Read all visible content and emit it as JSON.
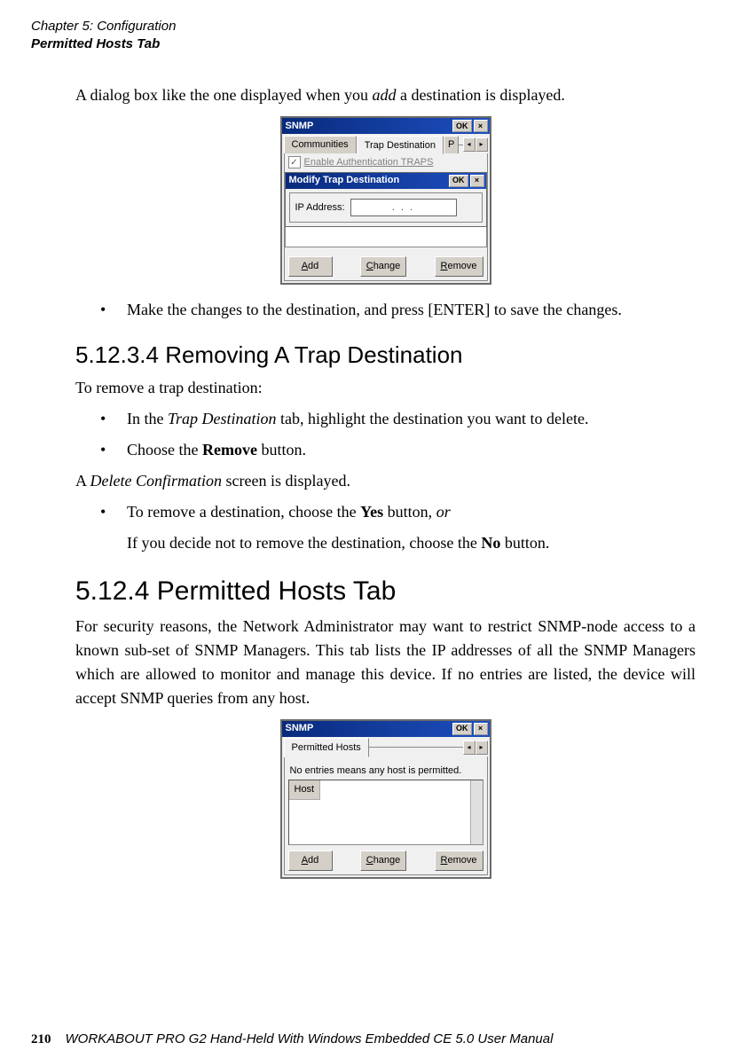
{
  "header": {
    "chapter": "Chapter 5: Configuration",
    "section": "Permitted Hosts Tab"
  },
  "body": {
    "p1_a": "A dialog box like the one displayed when you ",
    "p1_b": "add",
    "p1_c": " a destination is displayed.",
    "bullet_changes": "Make the changes to the destination, and press [ENTER] to save the changes.",
    "h_51234": "5.12.3.4   Removing A Trap Destination",
    "p_remove_intro": "To remove a trap destination:",
    "bullet_intrap_a": "In the ",
    "bullet_intrap_b": "Trap Destination",
    "bullet_intrap_c": " tab, highlight the destination you want to delete.",
    "bullet_choose_a": "Choose the ",
    "bullet_choose_b": "Remove",
    "bullet_choose_c": " button.",
    "p_delconf_a": "A ",
    "p_delconf_b": "Delete Confirmation",
    "p_delconf_c": " screen is displayed.",
    "bullet_yes_a": "To remove a destination, choose the ",
    "bullet_yes_b": "Yes",
    "bullet_yes_c": " button, ",
    "bullet_yes_d": "or",
    "sub_no_a": "If you decide not to remove the destination, choose the ",
    "sub_no_b": "No",
    "sub_no_c": " button.",
    "h_5124": "5.12.4   Permitted Hosts Tab",
    "p_permitted": "For security reasons, the Network Administrator may want to restrict SNMP-node access to a known sub-set of SNMP Managers. This tab lists the IP addresses of all the SNMP Managers which are allowed to monitor and manage this device. If no entries are listed, the device will accept SNMP queries from any host."
  },
  "dialog1": {
    "title": "SNMP",
    "ok": "OK",
    "close": "×",
    "tab1": "Communities",
    "tab2": "Trap Destination",
    "tab3": "P",
    "checkbox_label": "Enable Authentication TRAPS",
    "check": "✓",
    "arrow_left": "◂",
    "arrow_right": "▸",
    "inner_title": "Modify Trap Destination",
    "ip_label": "IP Address:",
    "ip_value": ".       .       .",
    "add_u": "A",
    "add_r": "dd",
    "change_u": "C",
    "change_r": "hange",
    "remove_u": "R",
    "remove_r": "emove"
  },
  "dialog2": {
    "title": "SNMP",
    "ok": "OK",
    "close": "×",
    "tab1": "Permitted Hosts",
    "arrow_left": "◂",
    "arrow_right": "▸",
    "info": "No entries means any host is permitted.",
    "col_host": "Host",
    "add_u": "A",
    "add_r": "dd",
    "change_u": "C",
    "change_r": "hange",
    "remove_u": "R",
    "remove_r": "emove"
  },
  "footer": {
    "page": "210",
    "title": "WORKABOUT PRO G2 Hand-Held With Windows Embedded CE 5.0 User Manual"
  }
}
